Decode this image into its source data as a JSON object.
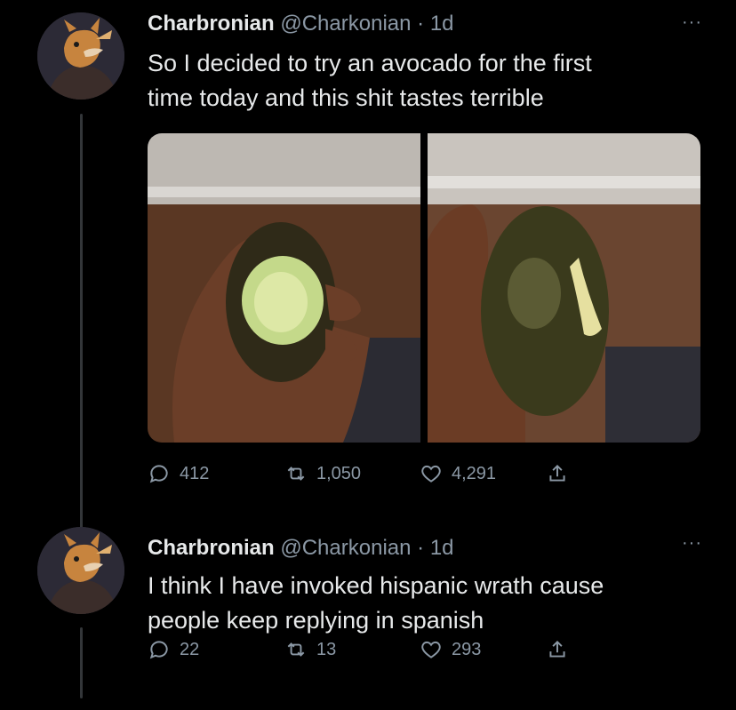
{
  "tweets": [
    {
      "author_name": "Charbronian",
      "author_handle": "@Charkonian",
      "separator": "·",
      "time": "1d",
      "text": "So I decided to try an avocado for the first\ntime today and this shit tastes terrible",
      "replies": "412",
      "retweets": "1,050",
      "likes": "4,291",
      "more_label": "···"
    },
    {
      "author_name": "Charbronian",
      "author_handle": "@Charkonian",
      "separator": "·",
      "time": "1d",
      "text": "I think I have invoked hispanic wrath cause\npeople keep replying in spanish",
      "replies": "22",
      "retweets": "13",
      "likes": "293",
      "more_label": "···"
    }
  ],
  "icons": {
    "reply": "reply-icon",
    "retweet": "retweet-icon",
    "like": "heart-icon",
    "share": "share-icon",
    "more": "more-icon"
  },
  "colors": {
    "background": "#000000",
    "text": "#e7e9ea",
    "secondary_text": "#8b98a5",
    "thread_line": "#333639"
  }
}
